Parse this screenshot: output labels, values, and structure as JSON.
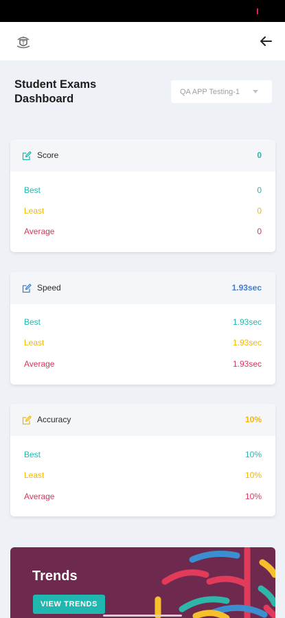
{
  "header": {
    "logo_icon": "school-crest-icon",
    "back_icon": "arrow-left-icon"
  },
  "page": {
    "title": "Student Exams Dashboard"
  },
  "test_selector": {
    "selected": "QA APP Testing-1"
  },
  "cards": [
    {
      "title": "Score",
      "value": "0",
      "icon": "edit-icon",
      "color": "#1fb7b0",
      "rows": [
        {
          "label": "Best",
          "value": "0"
        },
        {
          "label": "Least",
          "value": "0"
        },
        {
          "label": "Average",
          "value": "0"
        }
      ]
    },
    {
      "title": "Speed",
      "value": "1.93sec",
      "icon": "edit-icon",
      "color": "#3b7fd9",
      "rows": [
        {
          "label": "Best",
          "value": "1.93sec"
        },
        {
          "label": "Least",
          "value": "1.93sec"
        },
        {
          "label": "Average",
          "value": "1.93sec"
        }
      ]
    },
    {
      "title": "Accuracy",
      "value": "10%",
      "icon": "edit-icon",
      "color": "#f5b800",
      "rows": [
        {
          "label": "Best",
          "value": "10%"
        },
        {
          "label": "Least",
          "value": "10%"
        },
        {
          "label": "Average",
          "value": "10%"
        }
      ]
    }
  ],
  "row_colors": {
    "best": "#1fb7b0",
    "least": "#f5b800",
    "average": "#d6355d"
  },
  "trends": {
    "title": "Trends",
    "button_label": "VIEW TRENDS",
    "background": "#6e2a4e",
    "button_color": "#1fb7b0"
  }
}
